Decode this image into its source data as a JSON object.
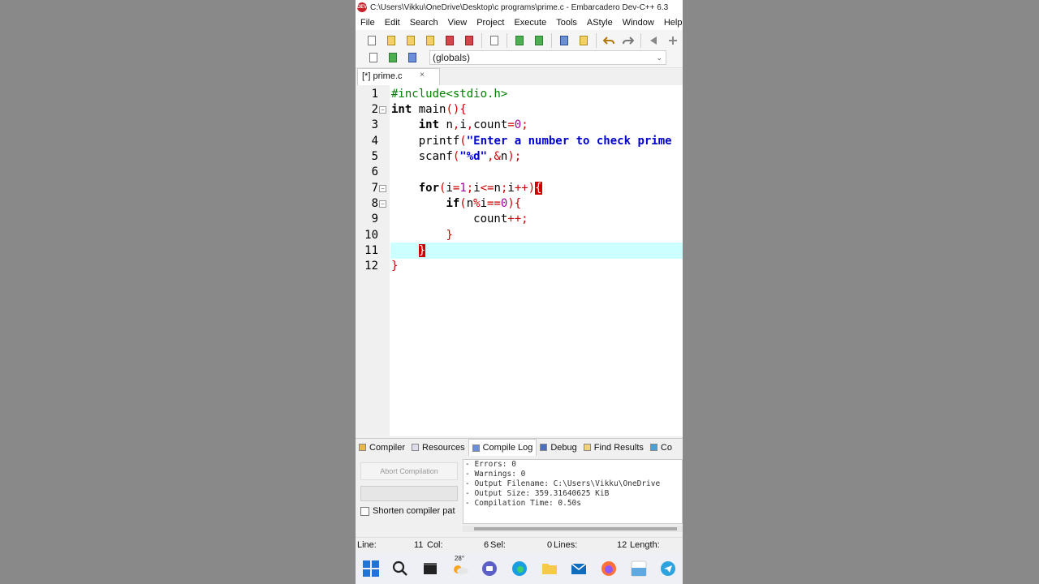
{
  "window": {
    "title": "C:\\Users\\Vikku\\OneDrive\\Desktop\\c programs\\prime.c - Embarcadero Dev-C++ 6.3",
    "app_icon_text": "DEV"
  },
  "menu": [
    "File",
    "Edit",
    "Search",
    "View",
    "Project",
    "Execute",
    "Tools",
    "AStyle",
    "Window",
    "Help"
  ],
  "scope_dropdown": "(globals)",
  "file_tab": {
    "label": "[*] prime.c",
    "close": "×"
  },
  "editor": {
    "line_numbers": [
      "1",
      "2",
      "3",
      "4",
      "5",
      "6",
      "7",
      "8",
      "9",
      "10",
      "11",
      "12"
    ],
    "current_line": 11,
    "lines": [
      "#include<stdio.h>",
      "int main(){",
      "    int n,i,count=0;",
      "    printf(\"Enter a number to check prime",
      "    scanf(\"%d\",&n);",
      "",
      "    for(i=1;i<=n;i++){",
      "        if(n%i==0){",
      "            count++;",
      "        }",
      "    }",
      "}"
    ]
  },
  "bottom_tabs": [
    {
      "label": "Compiler",
      "icon": "compiler-icon"
    },
    {
      "label": "Resources",
      "icon": "resources-icon"
    },
    {
      "label": "Compile Log",
      "icon": "compile-log-icon",
      "active": true
    },
    {
      "label": "Debug",
      "icon": "debug-icon"
    },
    {
      "label": "Find Results",
      "icon": "find-results-icon"
    },
    {
      "label": "Co",
      "icon": "console-icon"
    }
  ],
  "compile_panel": {
    "abort_label": "Abort Compilation",
    "shorten_label": "Shorten compiler pat",
    "log_lines": [
      "- Errors: 0",
      "- Warnings: 0",
      "- Output Filename: C:\\Users\\Vikku\\OneDrive",
      "- Output Size: 359.31640625 KiB",
      "- Compilation Time: 0.50s"
    ]
  },
  "status_bar": {
    "line_label": "Line:",
    "line_value": "11",
    "col_label": "Col:",
    "col_value": "6",
    "sel_label": "Sel:",
    "sel_value": "0",
    "lines_label": "Lines:",
    "lines_value": "12",
    "length_label": "Length:"
  },
  "taskbar": {
    "weather_temp": "28°",
    "icons": [
      "windows-start-icon",
      "search-icon",
      "terminal-icon",
      "weather-icon",
      "teams-icon",
      "edge-icon",
      "file-explorer-icon",
      "mail-icon",
      "firefox-icon",
      "amazon-icon",
      "telegram-icon"
    ]
  },
  "colors": {
    "keyword": "#000000",
    "preprocessor": "#008000",
    "string": "#0000d0",
    "number": "#a000a0",
    "symbol": "#cc0000",
    "current_line_bg": "#ccffff"
  }
}
